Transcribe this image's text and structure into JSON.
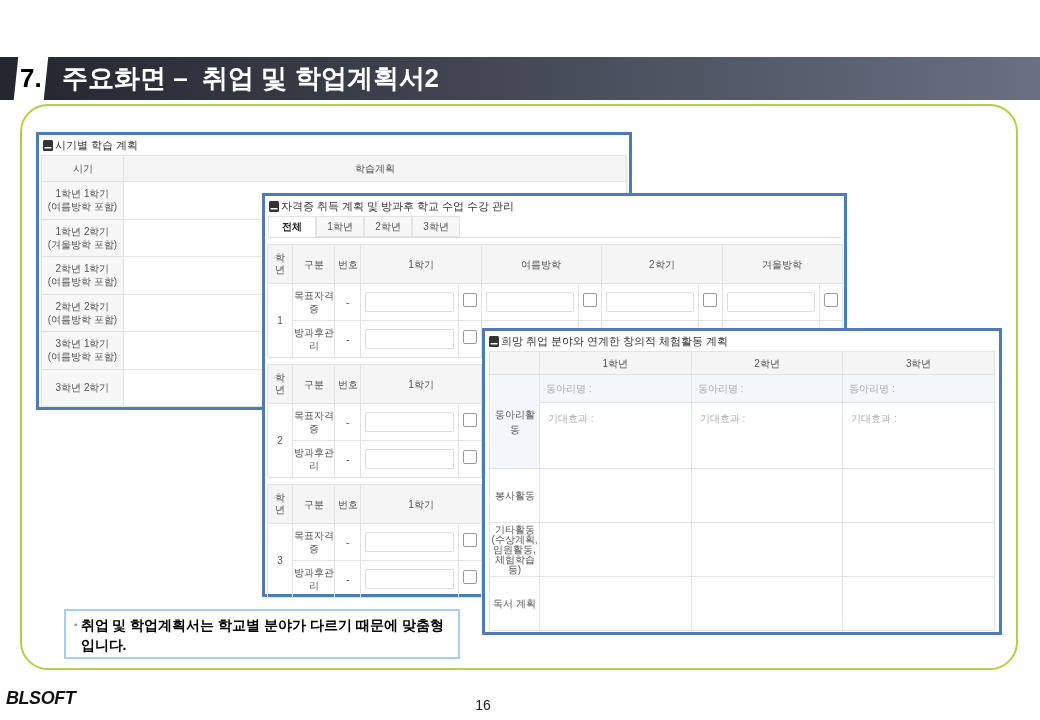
{
  "header": {
    "number": "7.",
    "title": "주요화면 –  취업 및 학업계획서2"
  },
  "study_plan": {
    "title": "시기별 학습 계획",
    "columns": [
      "시기",
      "학습계획"
    ],
    "rows": [
      "1학년 1학기 (여름방학 포함)",
      "1학년 2학기 (겨울방학 포함)",
      "2학년 1학기 (여름방학 포함)",
      "2학년 2학기 (여름방학 포함)",
      "3학년 1학기 (여름방학 포함)",
      "3학년 2학기"
    ]
  },
  "certificate_plan": {
    "title": "자격증 취득 계획 및 방과후 학교 수업 수강 관리",
    "tabs": [
      {
        "label": "전체",
        "selected": true
      },
      {
        "label": "1학년",
        "selected": false
      },
      {
        "label": "2학년",
        "selected": false
      },
      {
        "label": "3학년",
        "selected": false
      }
    ],
    "groups": [
      {
        "columns": [
          "학년",
          "구분",
          "번호"
        ],
        "terms": [
          "1학기",
          "여름방학",
          "2학기",
          "겨울방학"
        ],
        "grade": "1",
        "rows": [
          {
            "category": "목표자격증",
            "number": "-",
            "cells": [
              {
                "checked": false
              },
              {
                "checked": false
              },
              {
                "checked": false
              },
              {
                "checked": false
              }
            ]
          },
          {
            "category": "방과후관리",
            "number": "-",
            "cells": [
              {
                "checked": false
              }
            ]
          }
        ]
      },
      {
        "columns": [
          "학년",
          "구분",
          "번호"
        ],
        "terms": [
          "1학기"
        ],
        "grade": "2",
        "rows": [
          {
            "category": "목표자격증",
            "number": "-",
            "cells": [
              {
                "checked": false
              }
            ]
          },
          {
            "category": "방과후관리",
            "number": "-",
            "cells": [
              {
                "checked": false
              }
            ]
          }
        ]
      },
      {
        "columns": [
          "학년",
          "구분",
          "번호"
        ],
        "terms": [
          "1학기"
        ],
        "grade": "3",
        "rows": [
          {
            "category": "목표자격증",
            "number": "-",
            "cells": [
              {
                "checked": false
              }
            ]
          },
          {
            "category": "방과후관리",
            "number": "-",
            "cells": [
              {
                "checked": false
              }
            ]
          }
        ]
      }
    ]
  },
  "activity_plan": {
    "title": "희망 취업 분야와 연계한 창의적 체험활동 계획",
    "years": [
      "1학년",
      "2학년",
      "3학년"
    ],
    "rows": [
      {
        "kind": "club",
        "label": "동아리활동",
        "cells": [
          {
            "name_placeholder": "동아리명 :",
            "effect_placeholder": "기대효과 :"
          },
          {
            "name_placeholder": "동아리명 :",
            "effect_placeholder": "기대효과 :"
          },
          {
            "name_placeholder": "동아리명 :",
            "effect_placeholder": "기대효과 :"
          }
        ]
      },
      {
        "kind": "plain",
        "label": "봉사활동"
      },
      {
        "kind": "plain",
        "label": "기타활동 (수상계획,임원활동, 체험학습 등)"
      },
      {
        "kind": "plain",
        "label": "독서 계획"
      }
    ]
  },
  "note": {
    "bullet": "▪",
    "text": "취업 및 학업계획서는 학교별 분야가 다르기 때문에 맞춤형입니다."
  },
  "footer": {
    "logo": "BLSOFT",
    "page": "16"
  }
}
